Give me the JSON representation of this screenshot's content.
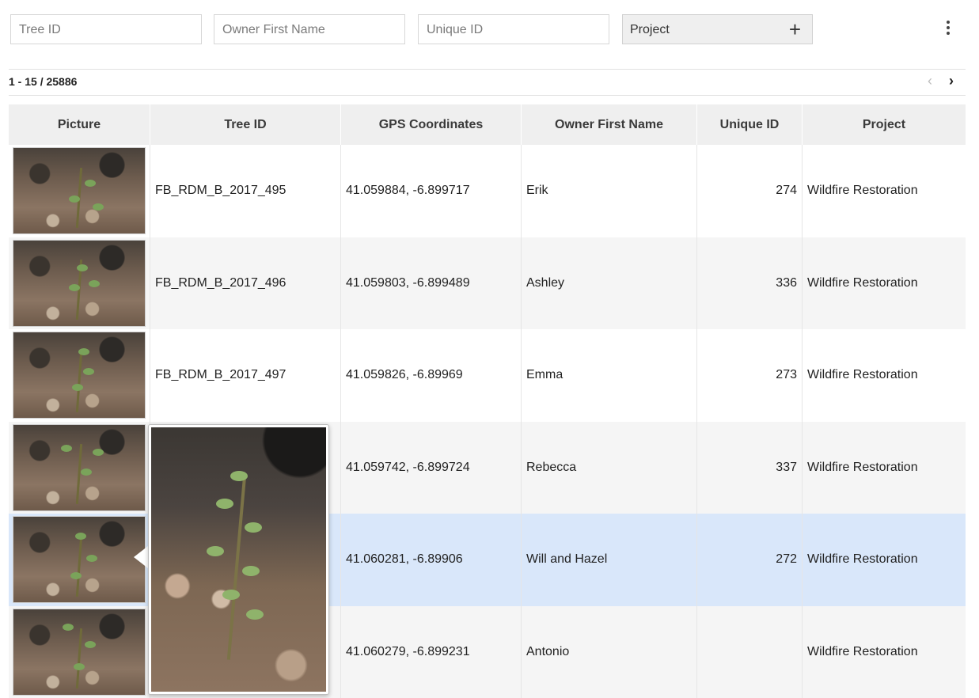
{
  "filters": {
    "tree_id_placeholder": "Tree ID",
    "owner_placeholder": "Owner First Name",
    "unique_id_placeholder": "Unique ID",
    "project_label": "Project",
    "add_icon": "+"
  },
  "pagination": {
    "range": "1 - 15 / 25886",
    "prev": "‹",
    "next": "›"
  },
  "columns": [
    "Picture",
    "Tree ID",
    "GPS Coordinates",
    "Owner First Name",
    "Unique ID",
    "Project"
  ],
  "rows": [
    {
      "tree_id": "FB_RDM_B_2017_495",
      "gps": "41.059884, -6.899717",
      "owner": "Erik",
      "unique_id": "274",
      "project": "Wildfire Restoration"
    },
    {
      "tree_id": "FB_RDM_B_2017_496",
      "gps": "41.059803, -6.899489",
      "owner": "Ashley",
      "unique_id": "336",
      "project": "Wildfire Restoration"
    },
    {
      "tree_id": "FB_RDM_B_2017_497",
      "gps": "41.059826, -6.89969",
      "owner": "Emma",
      "unique_id": "273",
      "project": "Wildfire Restoration"
    },
    {
      "tree_id": "",
      "gps": "41.059742, -6.899724",
      "owner": "Rebecca",
      "unique_id": "337",
      "project": "Wildfire Restoration"
    },
    {
      "tree_id": "",
      "gps": "41.060281, -6.89906",
      "owner": "Will and Hazel",
      "unique_id": "272",
      "project": "Wildfire Restoration"
    },
    {
      "tree_id": "",
      "gps": "41.060279, -6.899231",
      "owner": "Antonio",
      "unique_id": "",
      "project": "Wildfire Restoration"
    }
  ],
  "colors": {
    "selected_row": "#d9e7fa",
    "header_bg": "#efefef"
  }
}
